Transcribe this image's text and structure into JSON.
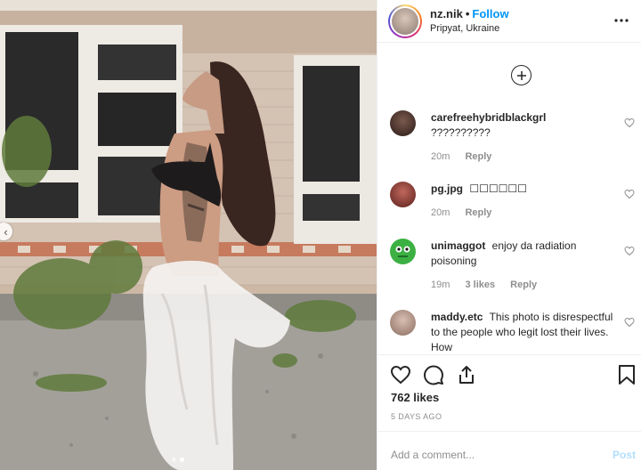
{
  "post": {
    "username": "nz.nik",
    "separator": "•",
    "follow_label": "Follow",
    "location": "Pripyat, Ukraine",
    "more_icon": "ellipsis-icon",
    "load_more_icon": "plus-circle-icon"
  },
  "photo": {
    "carousel_slides": 2,
    "active_slide": 1
  },
  "comments": [
    {
      "user": "carefreehybridblackgrl",
      "text": "??????????",
      "time": "20m",
      "likes": "",
      "reply": "Reply",
      "avatar_color": "#3a2a25"
    },
    {
      "user": "pg.jpg",
      "text": "☐☐☐☐☐☐",
      "time": "20m",
      "likes": "",
      "reply": "Reply",
      "avatar_color": "#8a3a36"
    },
    {
      "user": "unimaggot",
      "text": "enjoy da radiation poisoning",
      "time": "19m",
      "likes": "3 likes",
      "reply": "Reply",
      "avatar_color": "#3cb043"
    },
    {
      "user": "maddy.etc",
      "text": "This photo is disrespectful to the people who legit lost their lives. How",
      "time": "",
      "likes": "",
      "reply": "",
      "avatar_color": "#b79a8c"
    }
  ],
  "actions": {
    "likes_count": "762 likes",
    "date": "5 DAYS AGO"
  },
  "composer": {
    "placeholder": "Add a comment...",
    "post_label": "Post"
  }
}
